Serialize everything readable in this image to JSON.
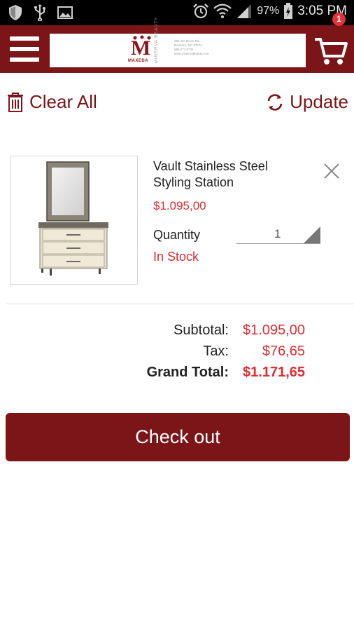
{
  "status_bar": {
    "battery_pct": "97%",
    "time": "3:05 PM"
  },
  "app_bar": {
    "logo_letter": "M",
    "logo_wordmark": "MAXEDA",
    "logo_vertical": "MINERVA BEAUTY",
    "logo_address": [
      "385 Jim Dixon Rd.",
      "Roxboro, NC 27574",
      "888.473.0733",
      "www.minervabeauty.com"
    ],
    "cart_count": "1"
  },
  "toolbar": {
    "clear_all": "Clear All",
    "update": "Update"
  },
  "cart_item": {
    "name": "Vault Stainless Steel Styling Station",
    "price": "$1.095,00",
    "quantity_label": "Quantity",
    "quantity_value": "1",
    "stock_status": "In Stock"
  },
  "totals": {
    "subtotal_label": "Subtotal:",
    "subtotal_value": "$1.095,00",
    "tax_label": "Tax:",
    "tax_value": "$76,65",
    "grand_total_label": "Grand Total:",
    "grand_total_value": "$1.171,65"
  },
  "checkout_label": "Check out",
  "colors": {
    "brand": "#7c1518",
    "price_red": "#e12b2f",
    "badge_red": "#e53238"
  }
}
